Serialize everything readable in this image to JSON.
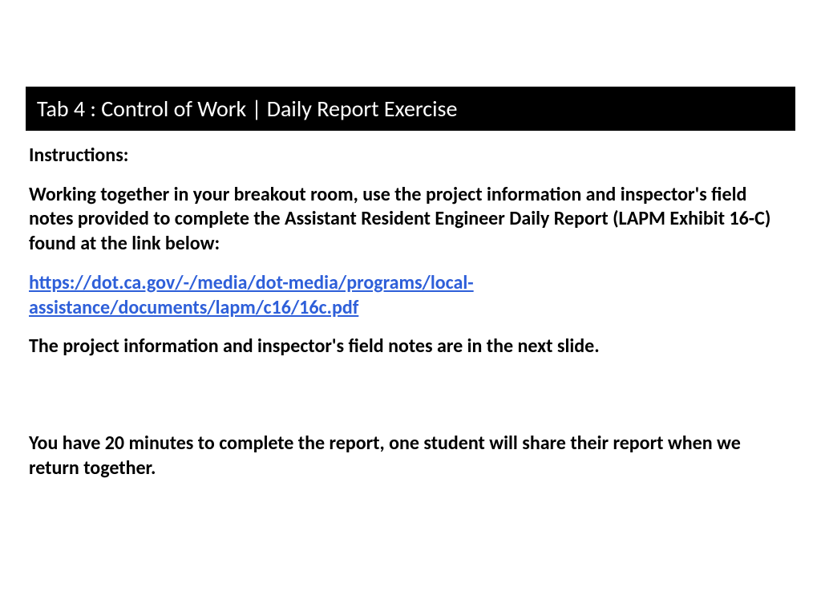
{
  "title": "Tab 4 : Control of Work | Daily Report Exercise",
  "instructions_label": "Instructions:",
  "paragraph1": "Working together in your breakout room, use the project information and inspector's field notes provided to complete the Assistant Resident Engineer Daily Report (LAPM Exhibit 16-C) found at the link below:",
  "link_text": "https://dot.ca.gov/-/media/dot-media/programs/local-assistance/documents/lapm/c16/16c.pdf",
  "link_href": "https://dot.ca.gov/-/media/dot-media/programs/local-assistance/documents/lapm/c16/16c.pdf",
  "paragraph2": "The project information and inspector's field notes are in the next slide.",
  "paragraph3": "You have 20 minutes to complete the report, one student will share their report when we return together."
}
